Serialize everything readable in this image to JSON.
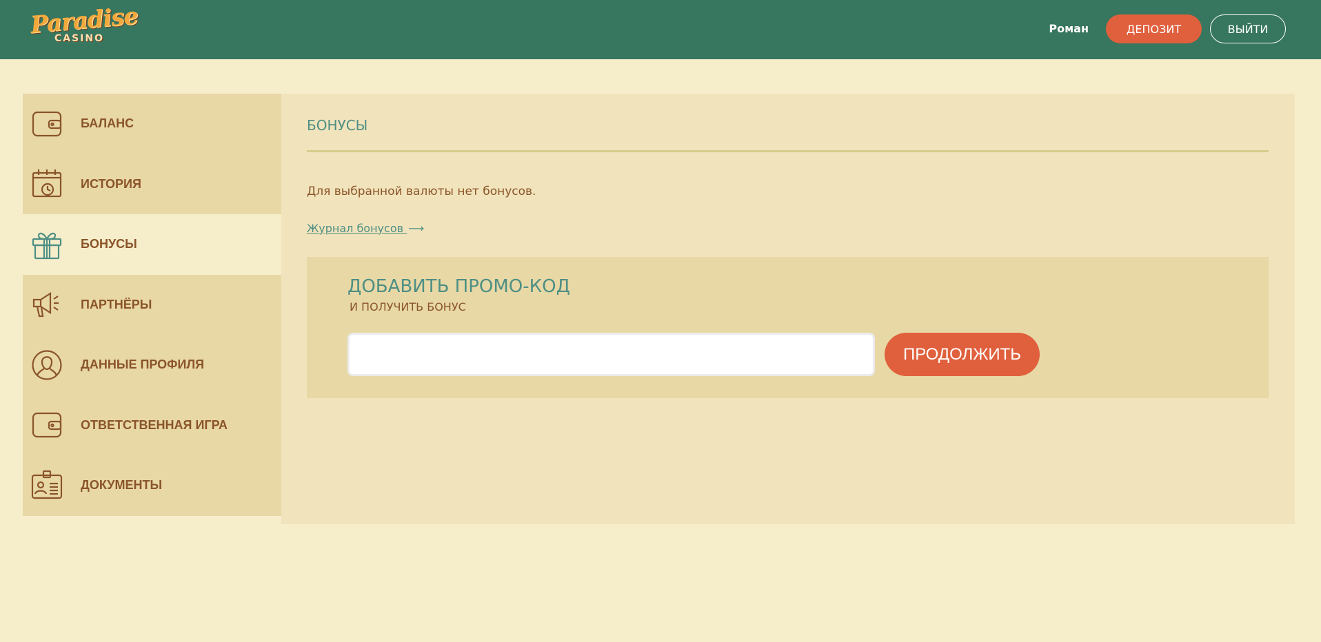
{
  "header": {
    "logo_text": "Paradise",
    "logo_sub": "CASINO",
    "username": "Роман",
    "deposit_label": "ДЕПОЗИТ",
    "logout_label": "ВЫЙТИ"
  },
  "sidebar": {
    "items": [
      {
        "label": "БАЛАНС",
        "icon": "wallet-icon",
        "active": false
      },
      {
        "label": "ИСТОРИЯ",
        "icon": "calendar-clock-icon",
        "active": false
      },
      {
        "label": "БОНУСЫ",
        "icon": "gift-icon",
        "active": true
      },
      {
        "label": "ПАРТНЁРЫ",
        "icon": "megaphone-icon",
        "active": false
      },
      {
        "label": "ДАННЫЕ ПРОФИЛЯ",
        "icon": "user-icon",
        "active": false
      },
      {
        "label": "ОТВЕТСТВЕННАЯ ИГРА",
        "icon": "wallet-icon",
        "active": false
      },
      {
        "label": "ДОКУМЕНТЫ",
        "icon": "id-card-icon",
        "active": false
      }
    ]
  },
  "main": {
    "title": "БОНУСЫ",
    "no_bonus_text": "Для выбранной валюты нет бонусов.",
    "journal_link": "Журнал бонусов",
    "promo": {
      "title": "ДОБАВИТЬ ПРОМО-КОД",
      "subtitle": "И ПОЛУЧИТЬ БОНУС",
      "input_value": "",
      "continue_label": "ПРОДОЛЖИТЬ"
    }
  },
  "colors": {
    "header_bg": "#37765f",
    "page_bg": "#f6edcb",
    "sidebar_bg": "#e8d8a6",
    "accent": "#e0603d",
    "teal_text": "#4e8f84",
    "brown_text": "#8a5429"
  }
}
